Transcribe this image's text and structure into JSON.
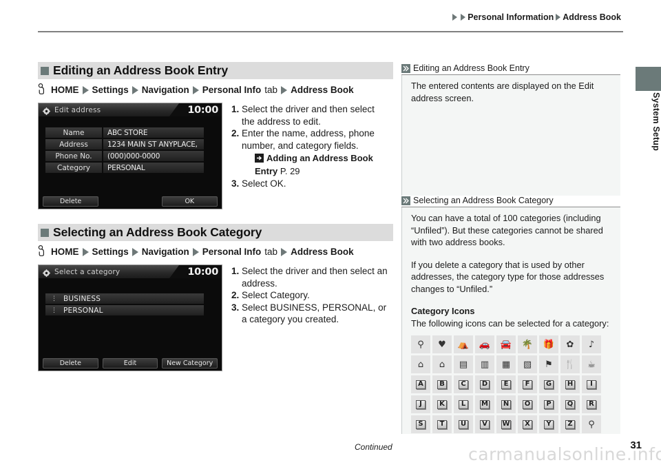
{
  "header": {
    "breadcrumb": [
      "Personal Information",
      "Address Book"
    ]
  },
  "side_tab": {
    "label": "System Setup",
    "block_color": "#6b7a79"
  },
  "sections": [
    {
      "title": "Editing an Address Book Entry",
      "path": {
        "home": "HOME",
        "items": [
          "Settings",
          "Navigation",
          "Personal Info"
        ],
        "tab_word": "tab",
        "last": "Address Book"
      },
      "screen": {
        "title": "Edit address",
        "clock": "10:00",
        "fields": [
          {
            "label": "Name",
            "value": "ABC STORE"
          },
          {
            "label": "Address",
            "value": "1234 MAIN ST ANYPLACE,"
          },
          {
            "label": "Phone No.",
            "value": "(000)000-0000"
          },
          {
            "label": "Category",
            "value": "PERSONAL"
          }
        ],
        "buttons": [
          "Delete",
          "OK"
        ]
      },
      "steps": [
        {
          "num": "1.",
          "text": "Select the driver and then select the address to edit."
        },
        {
          "num": "2.",
          "text": "Enter the name, address, phone number, and category fields."
        },
        {
          "num": "3.",
          "text": "Select OK."
        }
      ],
      "xref": {
        "title": "Adding an Address Book Entry",
        "page": "P. 29"
      }
    },
    {
      "title": "Selecting an Address Book Category",
      "path": {
        "home": "HOME",
        "items": [
          "Settings",
          "Navigation",
          "Personal Info"
        ],
        "tab_word": "tab",
        "last": "Address Book"
      },
      "screen": {
        "title": "Select a category",
        "clock": "10:00",
        "categories": [
          "BUSINESS",
          "PERSONAL"
        ],
        "buttons": [
          "Delete",
          "Edit",
          "New Category"
        ]
      },
      "steps": [
        {
          "num": "1.",
          "text": "Select the driver and then select an address."
        },
        {
          "num": "2.",
          "text": "Select Category."
        },
        {
          "num": "3.",
          "text": "Select BUSINESS, PERSONAL, or a category you created."
        }
      ]
    }
  ],
  "sidebar": [
    {
      "title": "Editing an Address Book Entry",
      "paragraphs": [
        "The entered contents are displayed on the Edit address screen."
      ]
    },
    {
      "title": "Selecting an Address Book Category",
      "paragraphs": [
        "You can have a total of 100 categories (including “Unfiled”). But these categories cannot be shared with two address books.",
        "If you delete a category that is used by other addresses, the category type for those addresses changes to “Unfiled.”"
      ],
      "icons_heading": "Category Icons",
      "icons_intro": "The following icons can be selected for a category:",
      "icon_rows": [
        [
          "pin-icon",
          "heart-icon",
          "tent-icon",
          "car-icon",
          "car2-icon",
          "island-icon",
          "gift-icon",
          "flower-icon",
          "music-note-icon"
        ],
        [
          "house1-icon",
          "house2-icon",
          "building1-icon",
          "building2-icon",
          "office1-icon",
          "office2-icon",
          "golf-flag-icon",
          "fork-knife-icon",
          "coffee-cup-icon"
        ],
        [
          "A",
          "B",
          "C",
          "D",
          "E",
          "F",
          "G",
          "H",
          "I"
        ],
        [
          "J",
          "K",
          "L",
          "M",
          "N",
          "O",
          "P",
          "Q",
          "R"
        ],
        [
          "S",
          "T",
          "U",
          "V",
          "W",
          "X",
          "Y",
          "Z",
          "pin-icon"
        ]
      ],
      "alpha_rows": [
        2,
        3,
        4
      ]
    }
  ],
  "footer": {
    "continued": "Continued",
    "page_number": "31",
    "watermark": "carmanualsonline.info"
  }
}
